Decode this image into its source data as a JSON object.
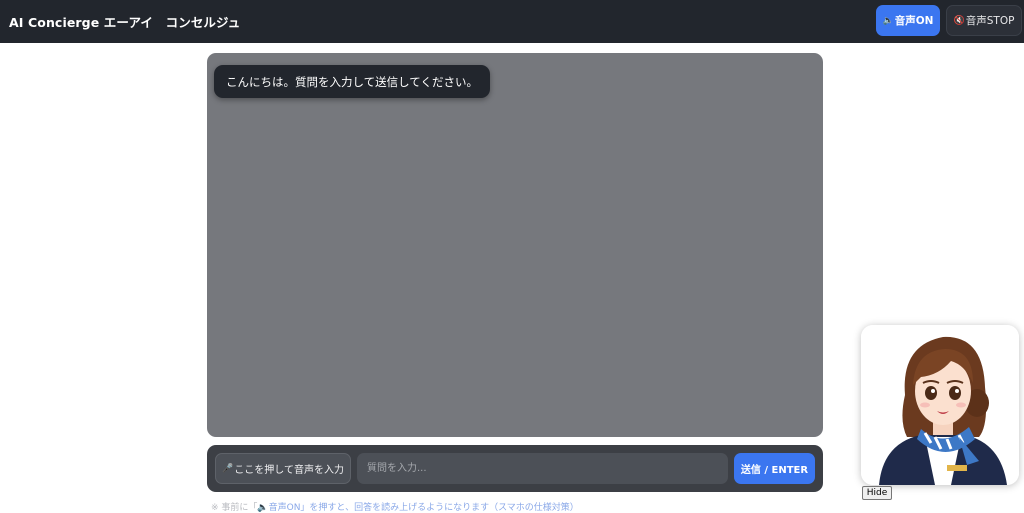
{
  "header": {
    "title": "AI Concierge エーアイ　コンセルジュ",
    "voice_on": {
      "icon": "speaker-icon",
      "glyph": "🔈",
      "label": "音声ON"
    },
    "voice_stop": {
      "icon": "speaker-muted-icon",
      "glyph": "🔇",
      "label": "音声STOP"
    }
  },
  "chat": {
    "messages": [
      {
        "role": "assistant",
        "text": "こんにちは。質問を入力して送信してください。"
      }
    ]
  },
  "input_bar": {
    "mic": {
      "icon": "microphone-icon",
      "glyph": "🎤",
      "label": "ここを押して音声を入力"
    },
    "question_placeholder": "質問を入力...",
    "send_label": "送信 / ENTER"
  },
  "hint": {
    "prefix": "※ 事前に「",
    "highlight": "🔈音声ON」を押すと、回答を読み上げるようになります（スマホの仕様対策）",
    "suffix": ""
  },
  "avatar": {
    "hide_label": "Hide"
  },
  "colors": {
    "header_bg": "#22262d",
    "accent": "#3b76f0",
    "chat_bg": "#76787d",
    "input_bar_bg": "#3c3f45"
  }
}
